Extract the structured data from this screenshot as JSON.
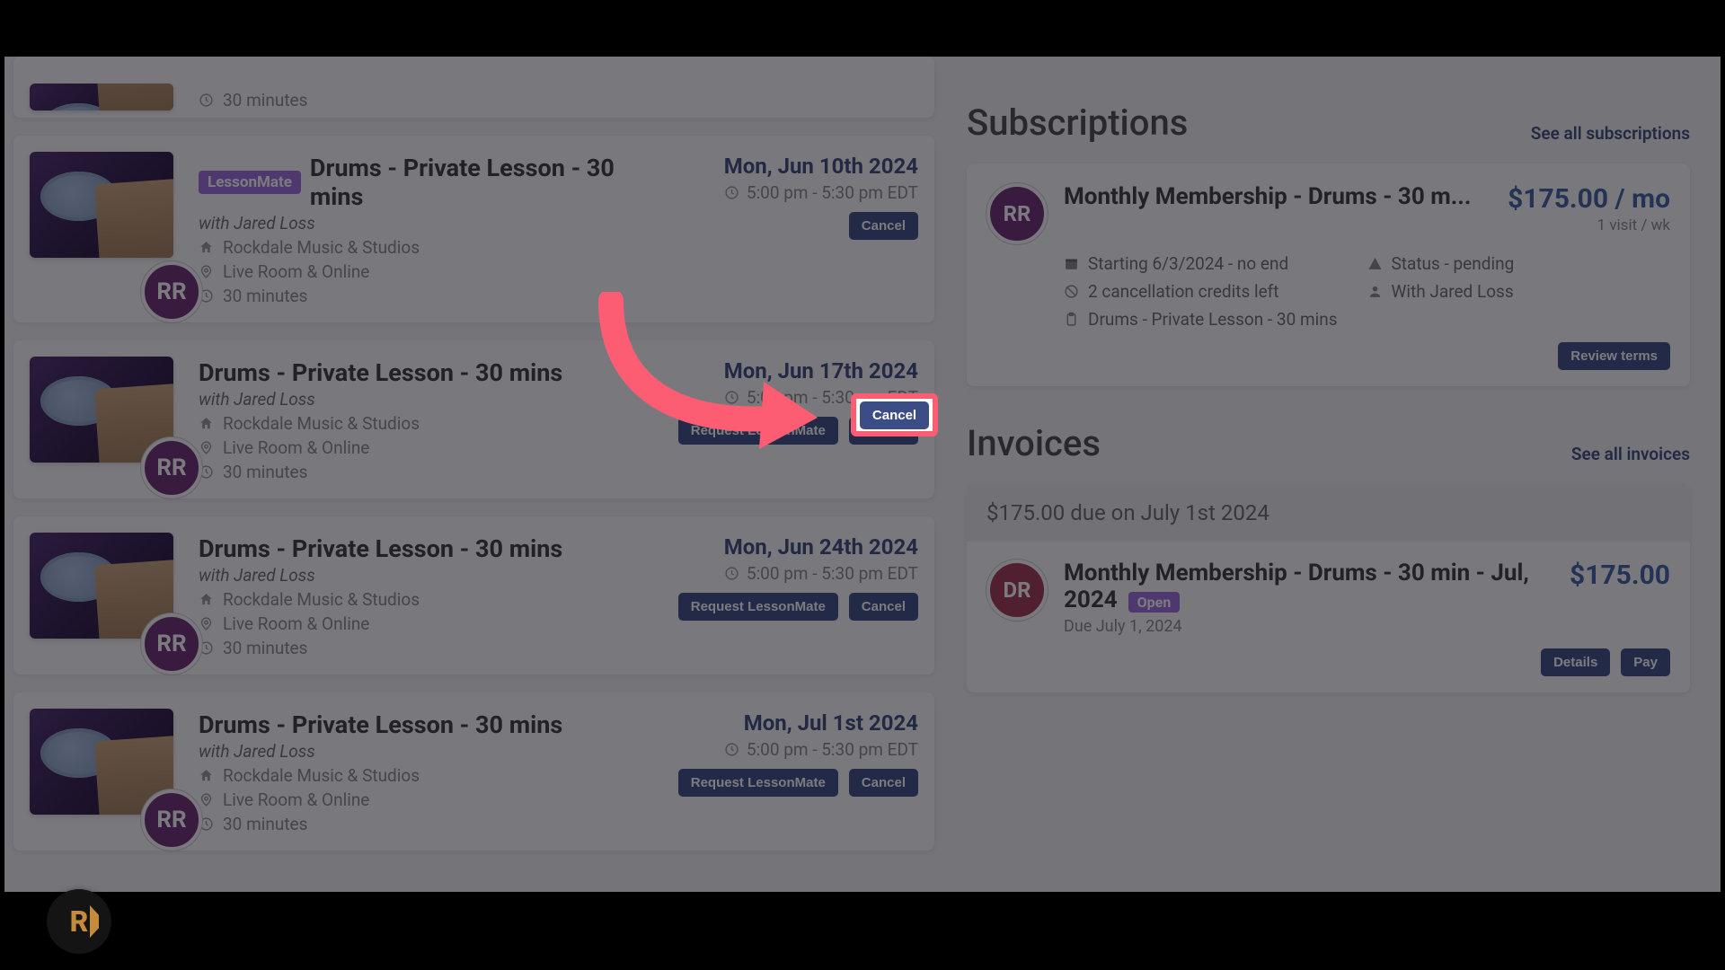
{
  "avatar_initials": "RR",
  "lessons": [
    {
      "title": "",
      "teacher": "",
      "studio": "",
      "room": "",
      "duration": "30 minutes",
      "date": "",
      "time": "",
      "badge": "",
      "buttons": []
    },
    {
      "badge": "LessonMate",
      "title": "Drums - Private Lesson - 30 mins",
      "teacher": "with Jared Loss",
      "studio": "Rockdale Music & Studios",
      "room": "Live Room & Online",
      "duration": "30 minutes",
      "date": "Mon, Jun 10th 2024",
      "time": "5:00 pm - 5:30 pm EDT",
      "buttons": [
        "Cancel"
      ]
    },
    {
      "badge": "",
      "title": "Drums - Private Lesson - 30 mins",
      "teacher": "with Jared Loss",
      "studio": "Rockdale Music & Studios",
      "room": "Live Room & Online",
      "duration": "30 minutes",
      "date": "Mon, Jun 17th 2024",
      "time": "5:00 pm - 5:30 pm EDT",
      "buttons": [
        "Request LessonMate",
        "Cancel"
      ]
    },
    {
      "badge": "",
      "title": "Drums - Private Lesson - 30 mins",
      "teacher": "with Jared Loss",
      "studio": "Rockdale Music & Studios",
      "room": "Live Room & Online",
      "duration": "30 minutes",
      "date": "Mon, Jun 24th 2024",
      "time": "5:00 pm - 5:30 pm EDT",
      "buttons": [
        "Request LessonMate",
        "Cancel"
      ]
    },
    {
      "badge": "",
      "title": "Drums - Private Lesson - 30 mins",
      "teacher": "with Jared Loss",
      "studio": "Rockdale Music & Studios",
      "room": "Live Room & Online",
      "duration": "30 minutes",
      "date": "Mon, Jul 1st 2024",
      "time": "5:00 pm - 5:30 pm EDT",
      "buttons": [
        "Request LessonMate",
        "Cancel"
      ]
    }
  ],
  "subscriptions": {
    "heading": "Subscriptions",
    "see_all": "See all subscriptions",
    "card": {
      "avatar": "RR",
      "title": "Monthly Membership - Drums - 30 m...",
      "price": "$175.00 / mo",
      "visits": "1 visit / wk",
      "starting": "Starting 6/3/2024 - no end",
      "status": "Status - pending",
      "credits": "2 cancellation credits left",
      "with": "With Jared Loss",
      "product": "Drums - Private Lesson - 30 mins",
      "review_btn": "Review terms"
    }
  },
  "invoices": {
    "heading": "Invoices",
    "see_all": "See all invoices",
    "due_bar": "$175.00 due on July 1st 2024",
    "card": {
      "avatar": "DR",
      "title": "Monthly Membership - Drums - 30 min - Jul, 2024",
      "badge": "Open",
      "price": "$175.00",
      "due": "Due July 1, 2024",
      "details_btn": "Details",
      "pay_btn": "Pay"
    }
  },
  "highlight_button": "Cancel"
}
